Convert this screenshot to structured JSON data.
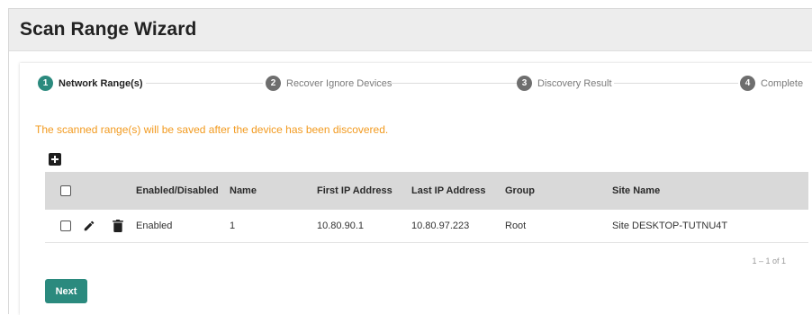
{
  "window": {
    "title": "Scan Range Wizard"
  },
  "stepper": {
    "steps": [
      {
        "number": "1",
        "label": "Network Range(s)",
        "state": "active"
      },
      {
        "number": "2",
        "label": "Recover Ignore Devices",
        "state": "inactive"
      },
      {
        "number": "3",
        "label": "Discovery Result",
        "state": "inactive"
      },
      {
        "number": "4",
        "label": "Complete",
        "state": "inactive"
      }
    ]
  },
  "notice": "The scanned range(s) will be saved after the device has been discovered.",
  "table": {
    "columns": [
      "Enabled/Disabled",
      "Name",
      "First IP Address",
      "Last IP Address",
      "Group",
      "Site Name"
    ],
    "rows": [
      {
        "enabled": "Enabled",
        "name": "1",
        "first_ip": "10.80.90.1",
        "last_ip": "10.80.97.223",
        "group": "Root",
        "site_name": "Site DESKTOP-TUTNU4T"
      }
    ]
  },
  "pagination": {
    "text": "1 – 1 of 1"
  },
  "footer": {
    "next_label": "Next"
  },
  "colors": {
    "accent": "#2b8a7e",
    "notice": "#f29a1f",
    "header_bg": "#d9d9d9"
  },
  "icons": [
    "add-icon",
    "edit-icon",
    "delete-icon"
  ]
}
